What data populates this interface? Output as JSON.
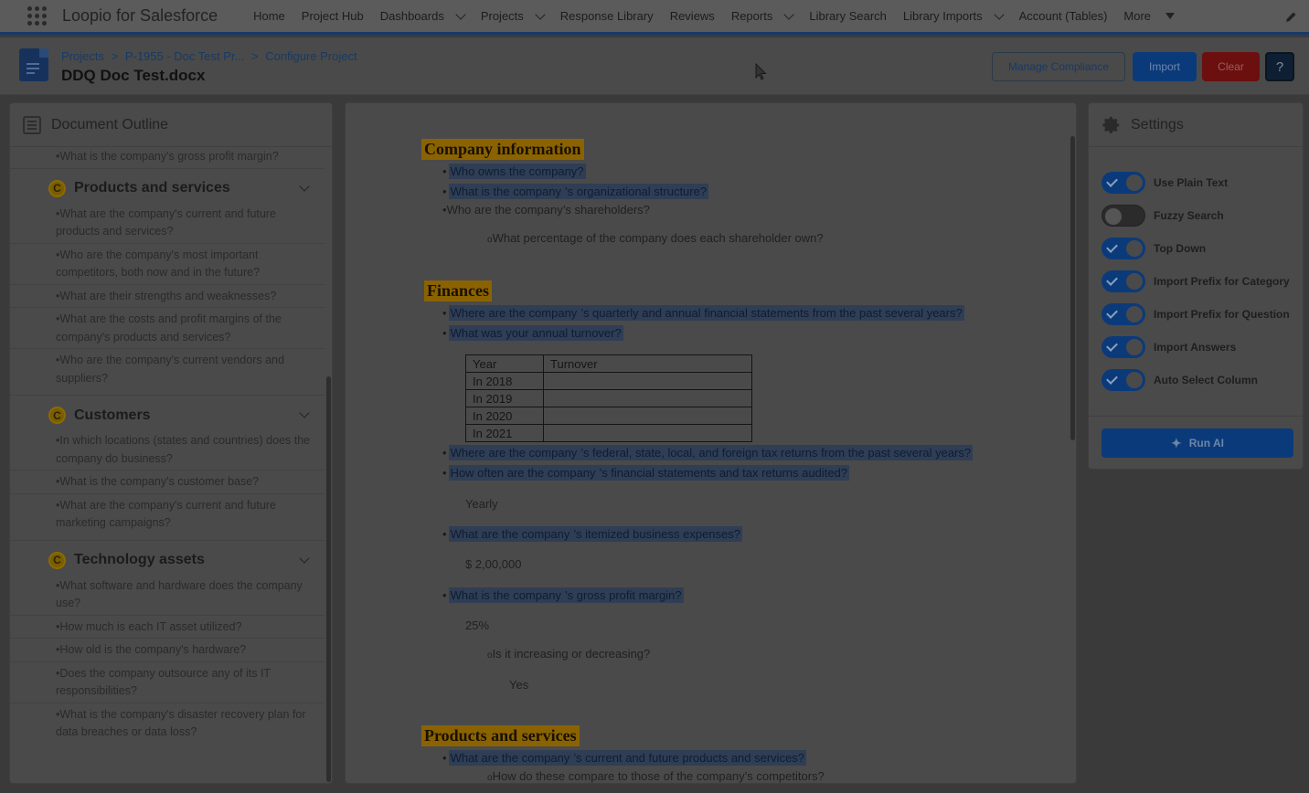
{
  "app": {
    "name": "Loopio for Salesforce"
  },
  "nav": {
    "items": [
      {
        "label": "Home",
        "dropdown": false
      },
      {
        "label": "Project Hub",
        "dropdown": false
      },
      {
        "label": "Dashboards",
        "dropdown": true
      },
      {
        "label": "Projects",
        "dropdown": true
      },
      {
        "label": "Response Library",
        "dropdown": false
      },
      {
        "label": "Reviews",
        "dropdown": false
      },
      {
        "label": "Reports",
        "dropdown": true
      },
      {
        "label": "Library Search",
        "dropdown": false
      },
      {
        "label": "Library Imports",
        "dropdown": true
      },
      {
        "label": "Account (Tables)",
        "dropdown": false
      }
    ],
    "more_label": "More"
  },
  "header": {
    "breadcrumb": [
      "Projects",
      "P-1955 - Doc Test Pr...",
      "Configure Project"
    ],
    "breadcrumb_separator": ">",
    "title": "DDQ Doc Test.docx",
    "buttons": {
      "manage_compliance": "Manage Compliance",
      "import": "Import",
      "clear": "Clear",
      "help": "?"
    }
  },
  "outline": {
    "title": "Document Outline",
    "top_question": "•What is the company's gross profit margin?",
    "categories": [
      {
        "badge": "C",
        "label": "Products and services",
        "questions": [
          "•What are the company's current and future products and services?",
          "•Who are the company's most important competitors, both now and in the future?",
          "•What are their strengths and weaknesses?",
          "•What are the costs and profit margins of the company's products and services?",
          "•Who are the company's current vendors and suppliers?"
        ]
      },
      {
        "badge": "C",
        "label": "Customers",
        "questions": [
          "•In which locations (states and countries) does the company do business?",
          "•What is the company's customer base?",
          "•What are the company's current and future marketing campaigns?"
        ]
      },
      {
        "badge": "C",
        "label": "Technology assets",
        "questions": [
          "•What software and hardware does the company use?",
          "•How much is each IT asset utilized?",
          "•How old is the company's hardware?",
          "•Does the company outsource any of its IT responsibilities?",
          "•What is the company's disaster recovery plan for data breaches or data loss?"
        ]
      }
    ]
  },
  "document": {
    "headings": {
      "company": "Company information",
      "finances": "Finances",
      "products": "Products and services"
    },
    "q_owner": "Who owns the company?",
    "q_org_a": "What is the company",
    "q_org_b": "’s organizational structure?",
    "q_shareholders": "Who are the company’s shareholders?",
    "q_pct": "What percentage of the company does each shareholder own?",
    "q_fin_a": "Where are the company",
    "q_fin_b": "’s quarterly and annual financial statements from the past several years?",
    "q_turnover": "What was your annual turnover?",
    "table": {
      "headers": [
        "Year",
        "Turnover"
      ],
      "rows": [
        [
          "In 2018",
          ""
        ],
        [
          "In 2019",
          ""
        ],
        [
          "In 2020",
          ""
        ],
        [
          "In 2021",
          ""
        ]
      ]
    },
    "q_tax_a": "Where are the company",
    "q_tax_b": "’s federal, state, local, and foreign tax returns from the past several years?",
    "q_audit_a": "How often are the company",
    "q_audit_b": "’s financial statements and tax returns audited?",
    "a_audit": "Yearly",
    "q_exp_a": "What are the company",
    "q_exp_b": "’s itemized business expenses?",
    "a_exp": "$ 2,00,000",
    "q_gpm_a": "What is the company",
    "q_gpm_b": "’s gross profit margin?",
    "a_gpm": "25%",
    "q_incr": "Is it increasing or decreasing?",
    "a_incr": "Yes",
    "q_prod_a": "What are the company",
    "q_prod_b": "’s current and future products and services?",
    "q_compare": "How do these compare to those of the company’s competitors?",
    "bullet": "•",
    "sub_bullet": "o"
  },
  "settings": {
    "title": "Settings",
    "toggles": [
      {
        "label": "Use Plain Text",
        "on": true
      },
      {
        "label": "Fuzzy Search",
        "on": false
      },
      {
        "label": "Top Down",
        "on": true
      },
      {
        "label": "Import Prefix for Category",
        "on": true
      },
      {
        "label": "Import Prefix for Question",
        "on": true
      },
      {
        "label": "Import Answers",
        "on": true
      },
      {
        "label": "Auto Select Column",
        "on": true
      }
    ],
    "run_ai": "Run AI"
  },
  "colors": {
    "brand_blue": "#0b3a7a",
    "clear_red": "#6b0f0f",
    "heading_highlight": "#8a6300",
    "question_highlight": "#2f3e55"
  }
}
